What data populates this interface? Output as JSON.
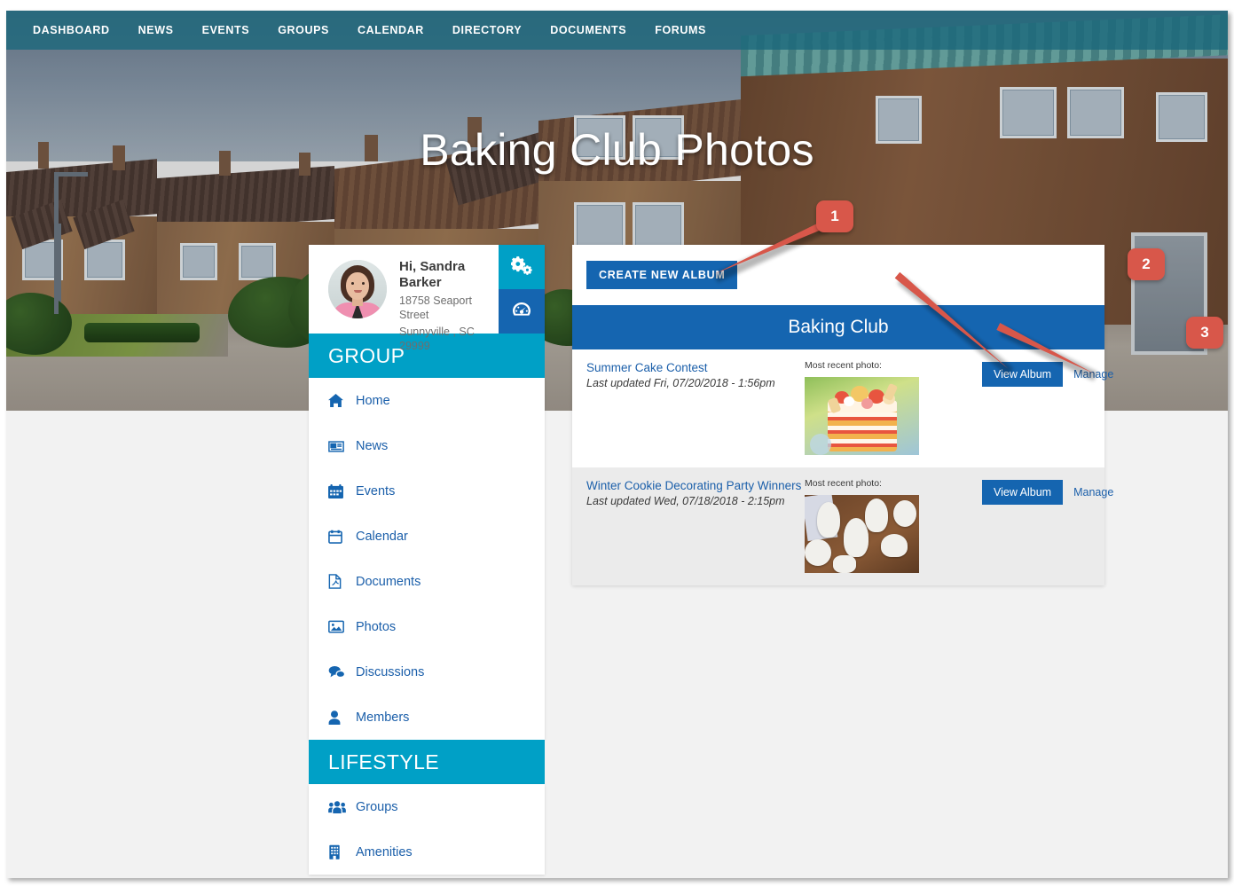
{
  "topnav": {
    "items": [
      {
        "label": "DASHBOARD",
        "name": "nav-dashboard"
      },
      {
        "label": "NEWS",
        "name": "nav-news"
      },
      {
        "label": "EVENTS",
        "name": "nav-events"
      },
      {
        "label": "GROUPS",
        "name": "nav-groups"
      },
      {
        "label": "CALENDAR",
        "name": "nav-calendar"
      },
      {
        "label": "DIRECTORY",
        "name": "nav-directory"
      },
      {
        "label": "DOCUMENTS",
        "name": "nav-documents"
      },
      {
        "label": "FORUMS",
        "name": "nav-forums"
      }
    ]
  },
  "hero": {
    "title": "Baking Club Photos"
  },
  "profile": {
    "greeting": "Hi, Sandra Barker",
    "address_line1": "18758 Seaport Street",
    "address_line2": "Sunnyville , SC 29999",
    "settings_icon": "gears-icon",
    "dashboard_icon": "dashboard-gauge-icon",
    "accent_settings": "#00a0c6",
    "accent_dashboard": "#1565b0"
  },
  "sidebar": {
    "group_header": "GROUP",
    "group_items": [
      {
        "label": "Home",
        "icon": "home-icon",
        "name": "sidebar-item-home"
      },
      {
        "label": "News",
        "icon": "newspaper-icon",
        "name": "sidebar-item-news"
      },
      {
        "label": "Events",
        "icon": "calendar-grid-icon",
        "name": "sidebar-item-events"
      },
      {
        "label": "Calendar",
        "icon": "calendar-icon",
        "name": "sidebar-item-calendar"
      },
      {
        "label": "Documents",
        "icon": "document-pdf-icon",
        "name": "sidebar-item-documents"
      },
      {
        "label": "Photos",
        "icon": "photo-icon",
        "name": "sidebar-item-photos"
      },
      {
        "label": "Discussions",
        "icon": "comments-icon",
        "name": "sidebar-item-discussions"
      },
      {
        "label": "Members",
        "icon": "user-icon",
        "name": "sidebar-item-members"
      }
    ],
    "lifestyle_header": "LIFESTYLE",
    "lifestyle_items": [
      {
        "label": "Groups",
        "icon": "users-group-icon",
        "name": "sidebar-item-groups"
      },
      {
        "label": "Amenities",
        "icon": "building-icon",
        "name": "sidebar-item-amenities"
      }
    ]
  },
  "main": {
    "create_album_label": "CREATE NEW ALBUM",
    "club_title": "Baking Club",
    "most_recent_label": "Most recent photo:",
    "view_album_label": "View Album",
    "manage_label": "Manage",
    "albums": [
      {
        "title": "Summer Cake Contest",
        "updated": "Last updated Fri, 07/20/2018 - 1:56pm",
        "thumbnail": "layered-strawberry-cake-photo",
        "row_style": "light"
      },
      {
        "title": "Winter Cookie Decorating Party Winners",
        "updated": "Last updated Wed, 07/18/2018 - 2:15pm",
        "thumbnail": "white-iced-mitten-cookies-photo",
        "row_style": "shade"
      }
    ]
  },
  "callouts": [
    {
      "number": "1",
      "target": "create-new-album-button"
    },
    {
      "number": "2",
      "target": "view-album-button-row-1"
    },
    {
      "number": "3",
      "target": "manage-link-row-1"
    }
  ],
  "colors": {
    "nav_bar": "#1c687c",
    "cyan": "#00a0c6",
    "blue": "#1565b0",
    "link": "#1b5faa",
    "callout_red": "#d8574a",
    "page_bg": "#f2f2f2",
    "row_shade": "#ebebeb"
  }
}
